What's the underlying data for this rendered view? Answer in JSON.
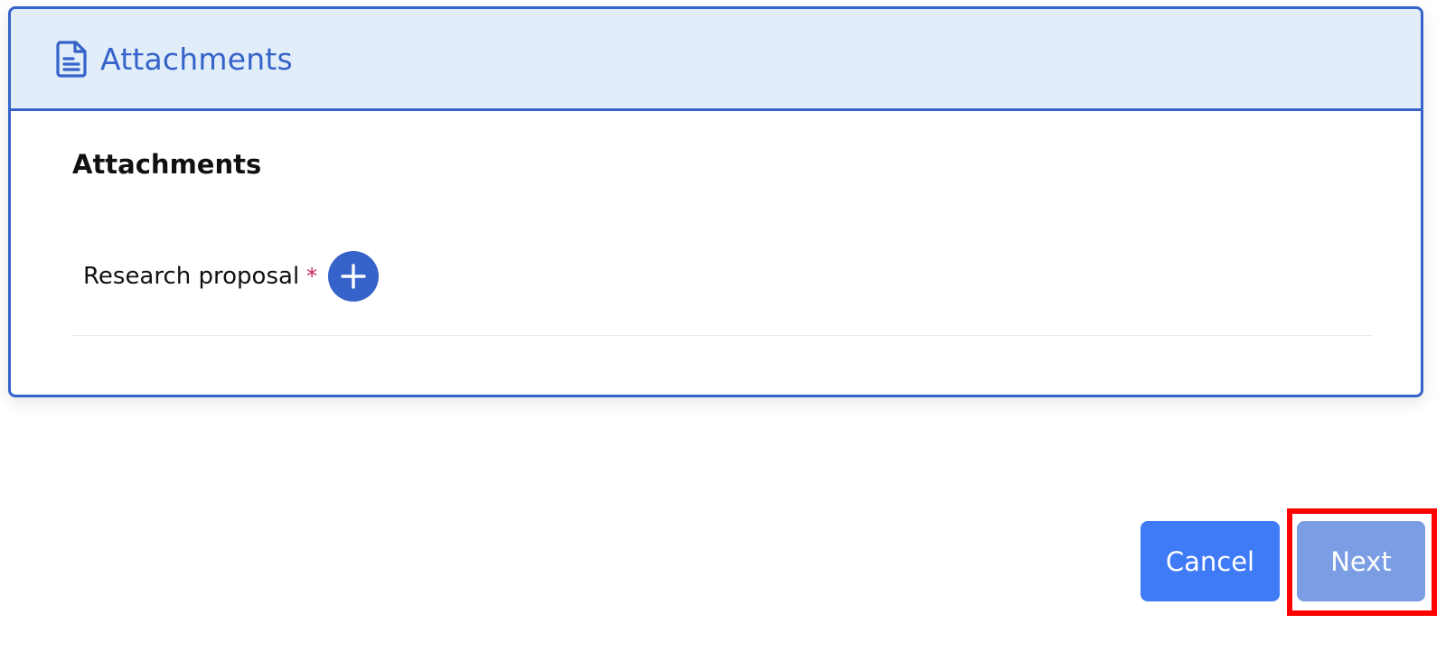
{
  "header": {
    "title": "Attachments",
    "icon": "document-icon"
  },
  "section": {
    "title": "Attachments"
  },
  "fields": [
    {
      "label": "Research proposal",
      "required_marker": "*",
      "action_icon": "plus-icon"
    }
  ],
  "footer": {
    "cancel_label": "Cancel",
    "next_label": "Next"
  },
  "colors": {
    "accent": "#3563c9",
    "header_bg": "#e1edf9",
    "cancel_bg": "#3f7bf6",
    "next_bg_disabled": "#7b9de4",
    "required": "#c4234b",
    "highlight": "#ff0000"
  }
}
